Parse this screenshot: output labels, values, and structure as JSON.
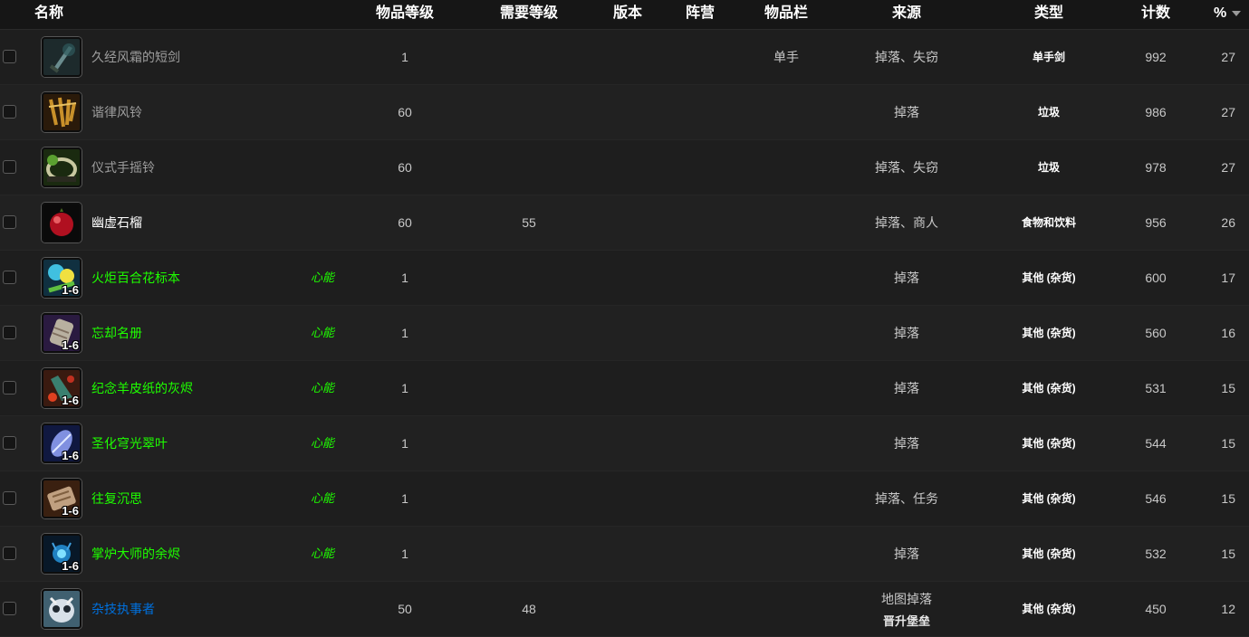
{
  "header": {
    "name": "名称",
    "item_level": "物品等级",
    "req_level": "需要等级",
    "version": "版本",
    "faction": "阵营",
    "slot": "物品栏",
    "source": "来源",
    "type": "类型",
    "count": "计数",
    "percent": "%"
  },
  "rows": [
    {
      "name": "久经风霜的短剑",
      "quality": "poor",
      "badge": "",
      "qty": "",
      "icon": "sword-icon",
      "item_level": "1",
      "req_level": "",
      "slot": "单手",
      "source": "掉落、失窃",
      "source2": "",
      "type": "单手剑",
      "count": "992",
      "percent": "27"
    },
    {
      "name": "谐律风铃",
      "quality": "poor",
      "badge": "",
      "qty": "",
      "icon": "chimes-icon",
      "item_level": "60",
      "req_level": "",
      "slot": "",
      "source": "掉落",
      "source2": "",
      "type": "垃圾",
      "count": "986",
      "percent": "27"
    },
    {
      "name": "仪式手摇铃",
      "quality": "poor",
      "badge": "",
      "qty": "",
      "icon": "bell-icon",
      "item_level": "60",
      "req_level": "",
      "slot": "",
      "source": "掉落、失窃",
      "source2": "",
      "type": "垃圾",
      "count": "978",
      "percent": "27"
    },
    {
      "name": "幽虚石榴",
      "quality": "common",
      "badge": "",
      "qty": "",
      "icon": "pomegranate-icon",
      "item_level": "60",
      "req_level": "55",
      "slot": "",
      "source": "掉落、商人",
      "source2": "",
      "type": "食物和饮料",
      "count": "956",
      "percent": "26"
    },
    {
      "name": "火炬百合花标本",
      "quality": "uncommon",
      "badge": "心能",
      "qty": "1-6",
      "icon": "flower-icon",
      "item_level": "1",
      "req_level": "",
      "slot": "",
      "source": "掉落",
      "source2": "",
      "type": "其他 (杂货)",
      "count": "600",
      "percent": "17"
    },
    {
      "name": "忘却名册",
      "quality": "uncommon",
      "badge": "心能",
      "qty": "1-6",
      "icon": "scroll-icon",
      "item_level": "1",
      "req_level": "",
      "slot": "",
      "source": "掉落",
      "source2": "",
      "type": "其他 (杂货)",
      "count": "560",
      "percent": "16"
    },
    {
      "name": "纪念羊皮纸的灰烬",
      "quality": "uncommon",
      "badge": "心能",
      "qty": "1-6",
      "icon": "ashes-icon",
      "item_level": "1",
      "req_level": "",
      "slot": "",
      "source": "掉落",
      "source2": "",
      "type": "其他 (杂货)",
      "count": "531",
      "percent": "15"
    },
    {
      "name": "圣化穹光翠叶",
      "quality": "uncommon",
      "badge": "心能",
      "qty": "1-6",
      "icon": "leaf-icon",
      "item_level": "1",
      "req_level": "",
      "slot": "",
      "source": "掉落",
      "source2": "",
      "type": "其他 (杂货)",
      "count": "544",
      "percent": "15"
    },
    {
      "name": "往复沉思",
      "quality": "uncommon",
      "badge": "心能",
      "qty": "1-6",
      "icon": "parchment-icon",
      "item_level": "1",
      "req_level": "",
      "slot": "",
      "source": "掉落、任务",
      "source2": "",
      "type": "其他 (杂货)",
      "count": "546",
      "percent": "15"
    },
    {
      "name": "掌炉大师的余烬",
      "quality": "uncommon",
      "badge": "心能",
      "qty": "1-6",
      "icon": "ember-icon",
      "item_level": "1",
      "req_level": "",
      "slot": "",
      "source": "掉落",
      "source2": "",
      "type": "其他 (杂货)",
      "count": "532",
      "percent": "15"
    },
    {
      "name": "杂技执事者",
      "quality": "rare",
      "badge": "",
      "qty": "",
      "icon": "owl-icon",
      "item_level": "50",
      "req_level": "48",
      "slot": "",
      "source": "地图掉落",
      "source2": "晋升堡垒",
      "type": "其他 (杂货)",
      "count": "450",
      "percent": "12"
    }
  ]
}
